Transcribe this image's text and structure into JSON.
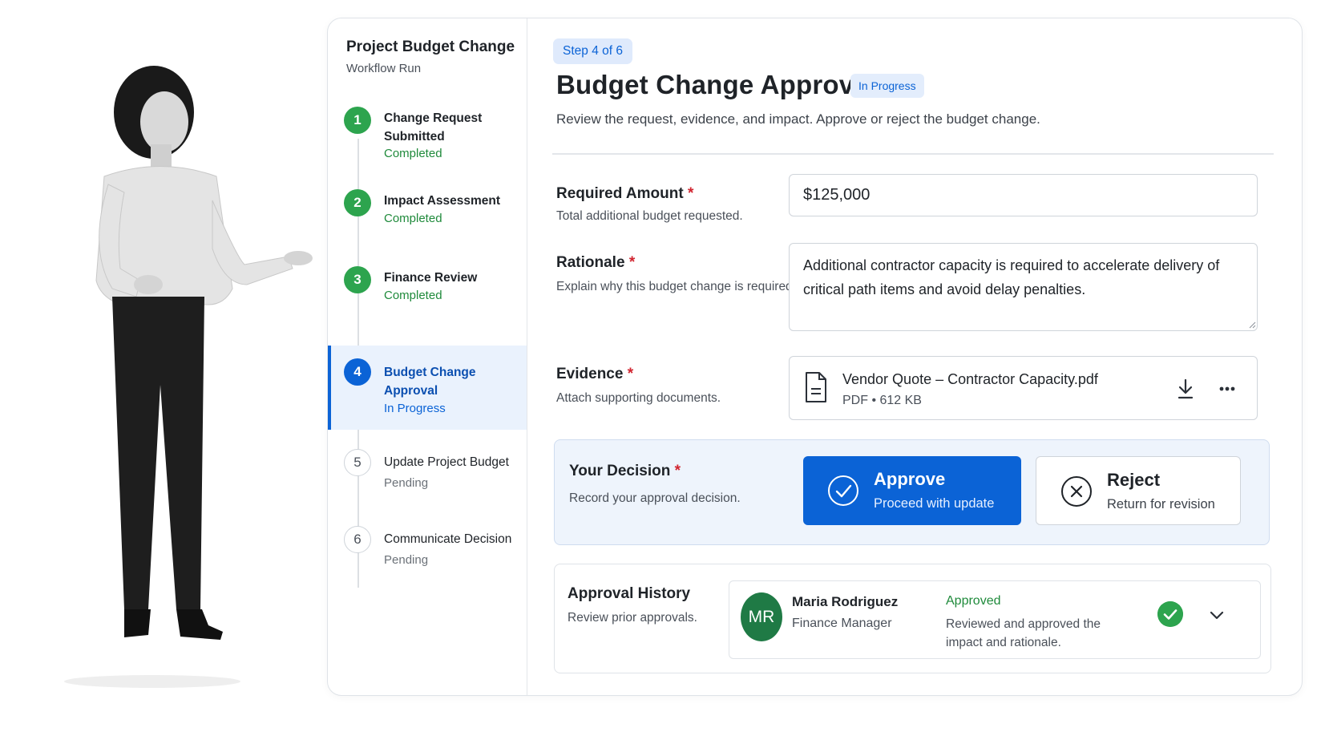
{
  "workflow": {
    "title": "Project Budget Change",
    "subtitle": "Workflow Run",
    "steps": [
      {
        "number": "1",
        "label": "Change Request Submitted",
        "status": "Completed"
      },
      {
        "number": "2",
        "label": "Impact Assessment",
        "status": "Completed"
      },
      {
        "number": "3",
        "label": "Finance Review",
        "status": "Completed"
      },
      {
        "number": "4",
        "label": "Budget Change Approval",
        "status": "In Progress"
      },
      {
        "number": "5",
        "label": "Update Project Budget",
        "status": "Pending"
      },
      {
        "number": "6",
        "label": "Communicate Decision",
        "status": "Pending"
      }
    ]
  },
  "main": {
    "step_chip": "Step 4 of 6",
    "title": "Budget Change Approval",
    "status_badge": "In Progress",
    "description": "Review the request, evidence, and impact. Approve or reject the budget change."
  },
  "fields": {
    "amount": {
      "label": "Required Amount",
      "required_mark": "*",
      "help": "Total additional budget requested.",
      "value": "$125,000"
    },
    "rationale": {
      "label": "Rationale",
      "required_mark": "*",
      "help": "Explain why this budget change is required.",
      "value": "Additional contractor capacity is required to accelerate delivery of critical path items and avoid delay penalties."
    },
    "evidence": {
      "label": "Evidence",
      "required_mark": "*",
      "help": "Attach supporting documents.",
      "file_name": "Vendor Quote – Contractor Capacity.pdf",
      "file_meta": "PDF • 612 KB"
    }
  },
  "decision": {
    "label": "Your Decision",
    "required_mark": "*",
    "help": "Record your approval decision.",
    "approve": {
      "title": "Approve",
      "subtitle": "Proceed with update"
    },
    "reject": {
      "title": "Reject",
      "subtitle": "Return for revision"
    }
  },
  "history": {
    "label": "Approval History",
    "help": "Review prior approvals.",
    "entries": [
      {
        "initials": "MR",
        "name": "Maria Rodriguez",
        "role": "Finance Manager",
        "status": "Approved",
        "note": "Reviewed and approved the impact and rationale."
      }
    ]
  },
  "colors": {
    "accent": "#0b63d6",
    "success": "#2da44e",
    "required": "#d1242f",
    "avatar": "#1f7a45"
  }
}
